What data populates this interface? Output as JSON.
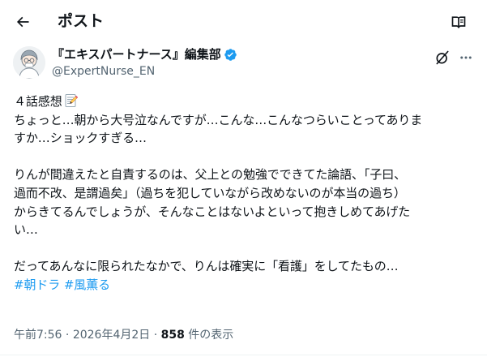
{
  "header": {
    "title": "ポスト",
    "back_icon": "arrow-left-icon",
    "reader_icon": "reader-book-icon"
  },
  "author": {
    "display_name": "『エキスパートナース』編集部",
    "handle": "@ExpertNurse_EN",
    "verified_color": "#1d9bf0",
    "verified_icon": "verified-badge-icon"
  },
  "actions": {
    "grok_icon": "grok-icon",
    "more_icon": "more-dots-icon"
  },
  "tweet": {
    "line1": "４話感想",
    "line1_emoji": "memo-pencil-emoji",
    "line2": "ちょっと…朝から大号泣なんですが…こんな…こんなつらいことってありま",
    "line3": "すか…ショックすぎる…",
    "line4": "りんが間違えたと自責するのは、父上との勉強でできてた論語、「子曰、",
    "line5": "過而不改、是謂過矣」（過ちを犯していながら改めないのが本当の過ち）",
    "line6": "からきてるんでしょうが、そんなことはないよといって抱きしめてあげた",
    "line7": "い…",
    "line8": "だってあんなに限られたなかで、りんは確実に「看護」をしてたもの…",
    "hashtag1": "#朝ドラ",
    "hashtag2": "#風薫る"
  },
  "meta": {
    "time": "午前7:56",
    "separator": " · ",
    "date": "2026年4月2日",
    "views_count": "858",
    "views_label": " 件の表示"
  },
  "colors": {
    "text": "#0f1419",
    "secondary": "#536471",
    "accent": "#1d9bf0"
  }
}
